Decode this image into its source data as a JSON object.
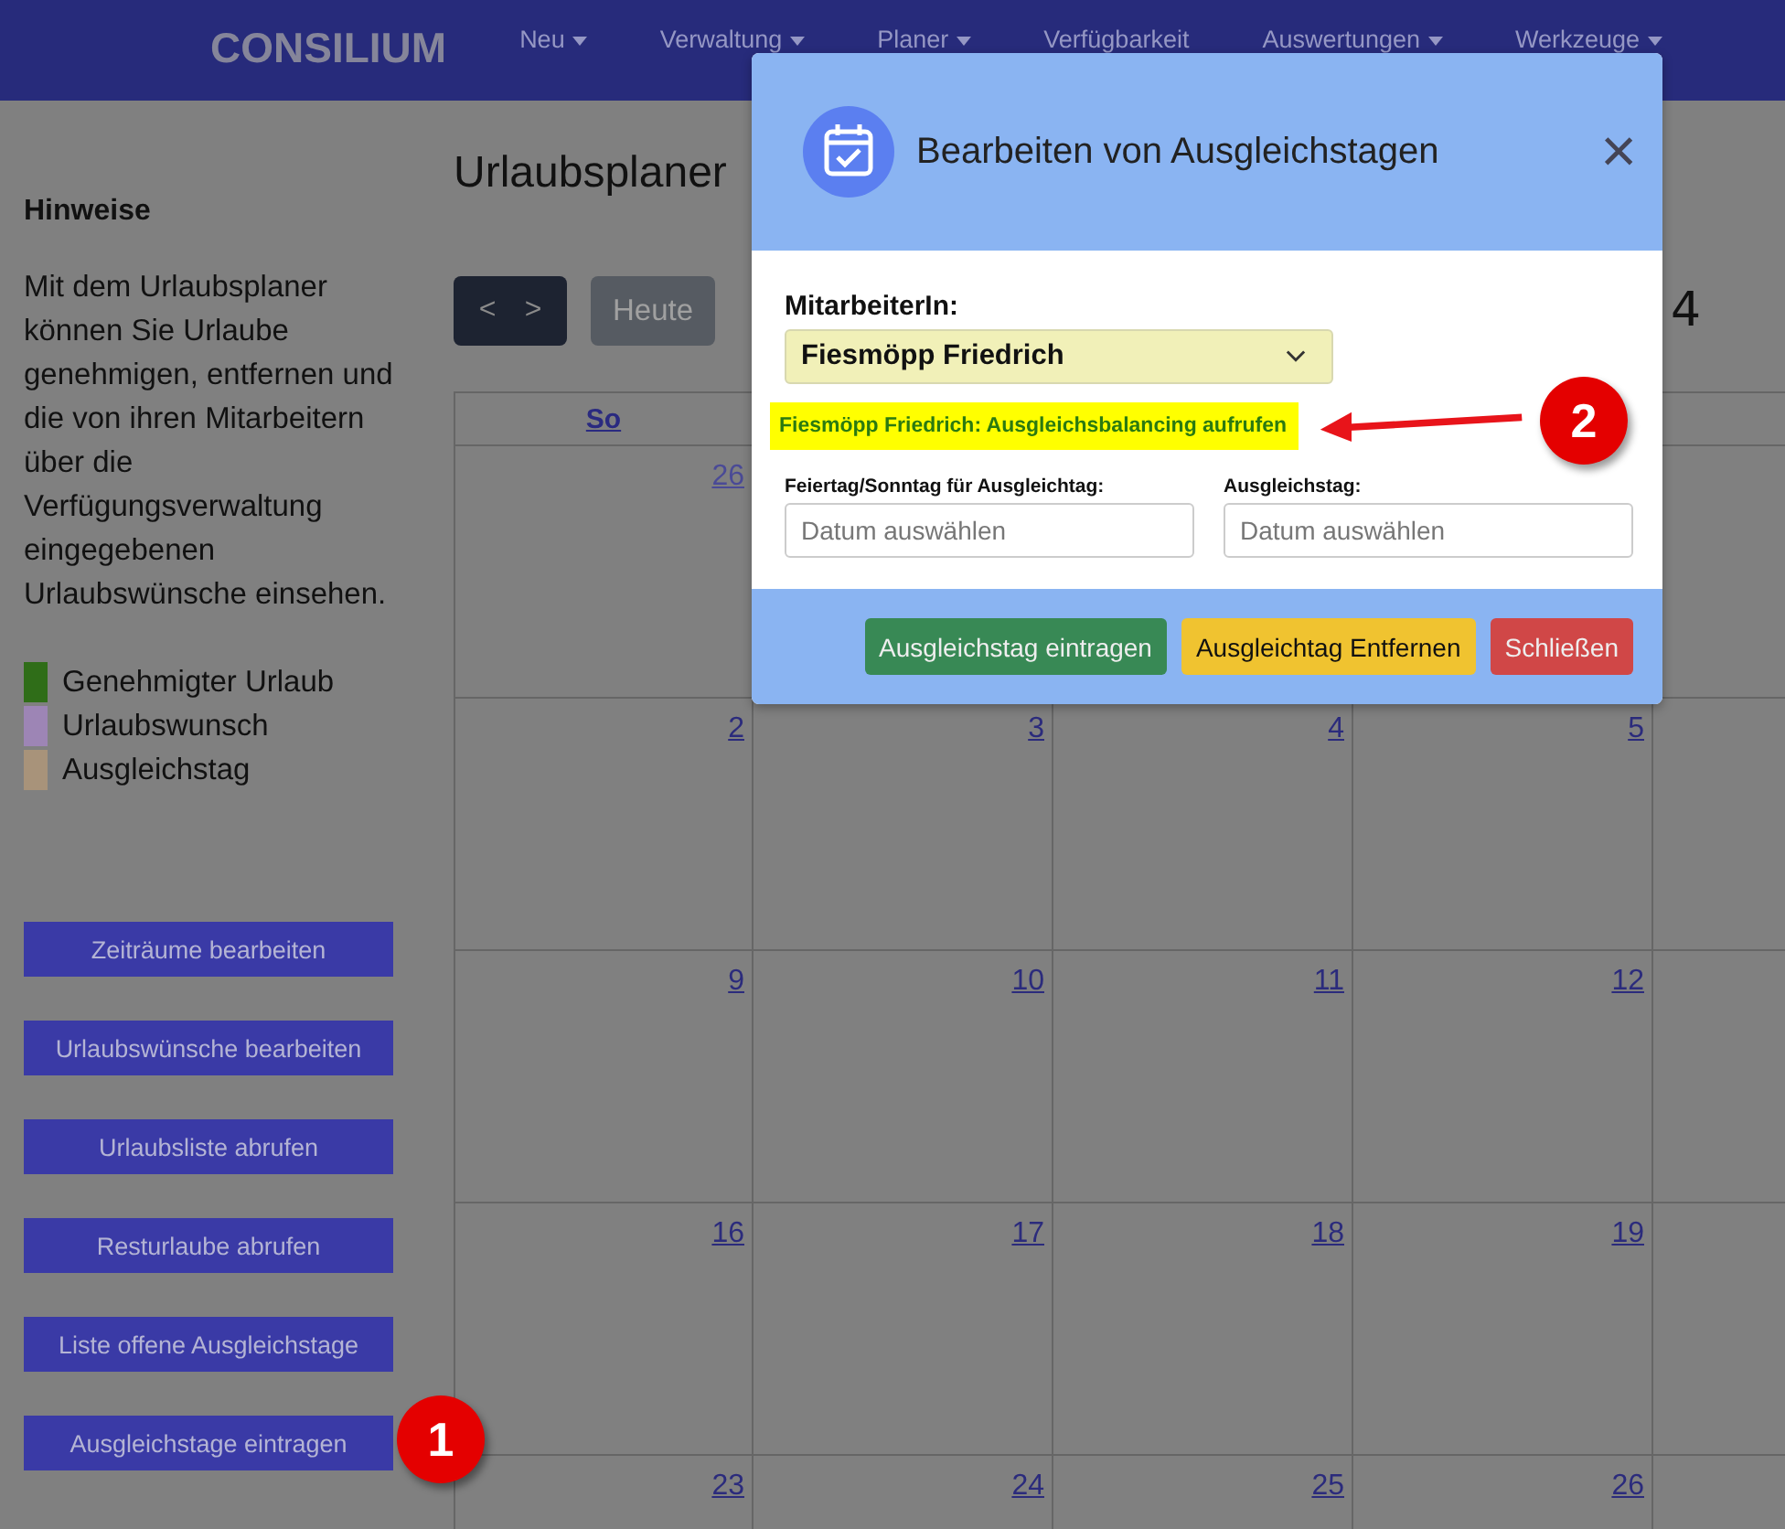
{
  "navbar": {
    "logo": "CONSILIUM",
    "items": [
      {
        "label": "Neu",
        "dropdown": true
      },
      {
        "label": "Verwaltung",
        "dropdown": true
      },
      {
        "label": "Planer",
        "dropdown": true
      },
      {
        "label": "Verfügbarkeit",
        "dropdown": false
      },
      {
        "label": "Auswertungen",
        "dropdown": true
      },
      {
        "label": "Werkzeuge",
        "dropdown": true
      }
    ]
  },
  "sidebar": {
    "heading": "Hinweise",
    "text": "Mit dem Urlaubsplaner können Sie Urlaube genehmigen, entfernen und die von ihren Mitarbeitern über die Verfügungsverwaltung eingegebenen Urlaubswünsche einsehen.",
    "legend": [
      {
        "label": "Genehmigter Urlaub",
        "color": "#2f6d18"
      },
      {
        "label": "Urlaubswunsch",
        "color": "#9d85b5"
      },
      {
        "label": "Ausgleichstag",
        "color": "#a8937a"
      }
    ],
    "buttons": [
      "Zeiträume bearbeiten",
      "Urlaubswünsche bearbeiten",
      "Urlaubsliste abrufen",
      "Resturlaube abrufen",
      "Liste offene Ausgleichstage",
      "Ausgleichstage eintragen"
    ]
  },
  "main": {
    "title": "Urlaubsplaner",
    "prev": "<",
    "next": ">",
    "today": "Heute",
    "month_fragment": "4",
    "calendar": {
      "weekday_headers": [
        "So"
      ],
      "weeks": [
        {
          "days": [
            {
              "label": "26",
              "other_month": true
            }
          ]
        },
        {
          "days": [
            {
              "label": "2",
              "other_month": false
            },
            {
              "label": "3",
              "other_month": false
            },
            {
              "label": "4",
              "other_month": false
            },
            {
              "label": "5",
              "other_month": false
            }
          ]
        },
        {
          "days": [
            {
              "label": "9",
              "other_month": false
            },
            {
              "label": "10",
              "other_month": false
            },
            {
              "label": "11",
              "other_month": false
            },
            {
              "label": "12",
              "other_month": false
            }
          ]
        },
        {
          "days": [
            {
              "label": "16",
              "other_month": false
            },
            {
              "label": "17",
              "other_month": false
            },
            {
              "label": "18",
              "other_month": false
            },
            {
              "label": "19",
              "other_month": false
            }
          ]
        },
        {
          "days": [
            {
              "label": "23",
              "other_month": false
            },
            {
              "label": "24",
              "other_month": false
            },
            {
              "label": "25",
              "other_month": false
            },
            {
              "label": "26",
              "other_month": false
            }
          ]
        }
      ]
    }
  },
  "modal": {
    "title": "Bearbeiten von Ausgleichstagen",
    "close": "×",
    "employee_label": "MitarbeiterIn:",
    "employee_value": "Fiesmöpp Friedrich",
    "balancing_link": "Fiesmöpp Friedrich: Ausgleichsbalancing aufrufen",
    "date_fields": [
      {
        "label": "Feiertag/Sonntag für Ausgleichtag:",
        "placeholder": "Datum auswählen"
      },
      {
        "label": "Ausgleichstag:",
        "placeholder": "Datum auswählen"
      }
    ],
    "buttons": [
      {
        "label": "Ausgleichstag eintragen",
        "kind": "success"
      },
      {
        "label": "Ausgleichtag Entfernen",
        "kind": "warning"
      },
      {
        "label": "Schließen",
        "kind": "danger"
      }
    ]
  },
  "annotations": [
    "1",
    "2"
  ]
}
